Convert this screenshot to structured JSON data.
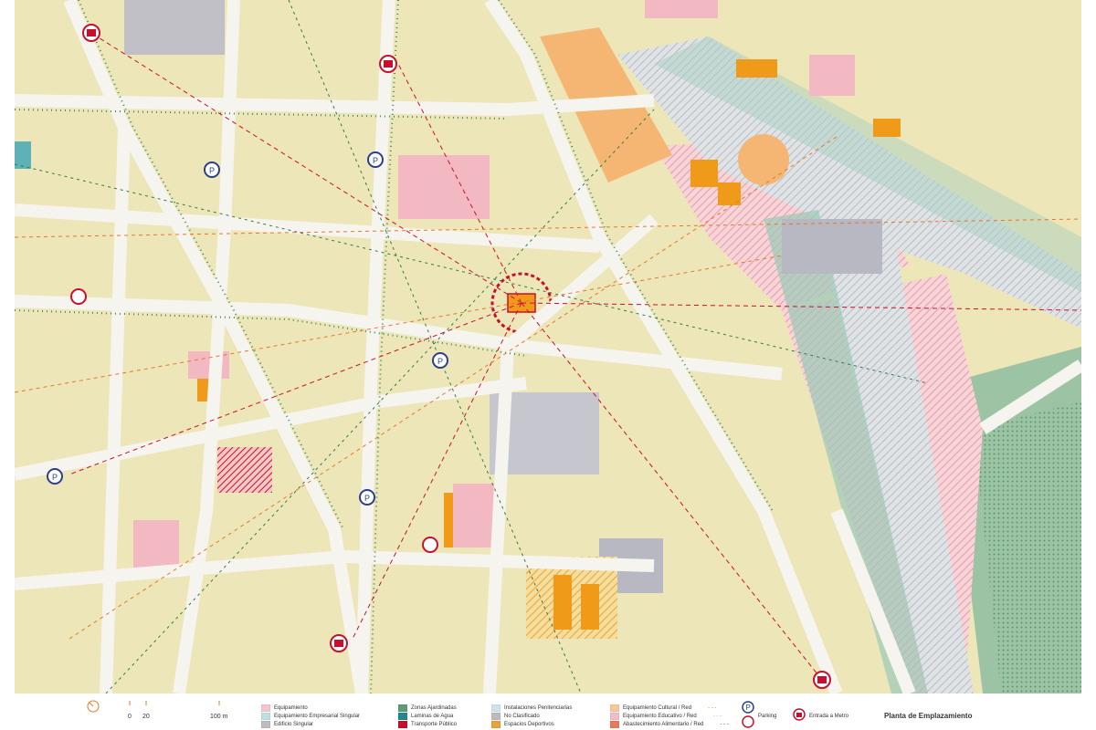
{
  "legend": {
    "scale": {
      "zero": "0",
      "twenty": "20",
      "hundred": "100 m"
    },
    "col1": [
      {
        "label": "Equipamiento",
        "color": "#f2c6cf",
        "pattern": "hatch"
      },
      {
        "label": "Equipamiento Empresarial Singular",
        "color": "#bfe0de"
      },
      {
        "label": "Edificio Singular",
        "color": "#bdbdbd"
      }
    ],
    "col2": [
      {
        "label": "Zonas Ajardinadas",
        "color": "#5d9a7a"
      },
      {
        "label": "Laminas de Agua",
        "color": "#1e8a8a"
      },
      {
        "label": "Transporte Público",
        "color": "#c8102e"
      }
    ],
    "col3": [
      {
        "label": "Instalaciones Penitenciarias",
        "color": "#cde3ec",
        "pattern": "hatch"
      },
      {
        "label": "No Clasificado",
        "color": "#bcbcbc",
        "pattern": "hatch"
      },
      {
        "label": "Espacios Deportivos",
        "color": "#e8a23c",
        "pattern": "hatch"
      }
    ],
    "col4": [
      {
        "label": "Equipamiento Cultural / Red",
        "color": "#f6c79a"
      },
      {
        "label": "Equipamiento Educativo / Red",
        "color": "#f2bcc8"
      },
      {
        "label": "Abastecimiento Alimentario / Red",
        "color": "#e57b5e"
      }
    ],
    "parking": "Parking",
    "metro": "Entrada a Metro",
    "title": "Planta de Emplazamiento"
  },
  "colors": {
    "block": "#ece6b8",
    "street": "#f3f1ec",
    "green": "#5d9a7a",
    "pink": "#f2b9c3",
    "orange": "#f09a1a",
    "red": "#c8102e",
    "grey": "#b8b8c2"
  }
}
